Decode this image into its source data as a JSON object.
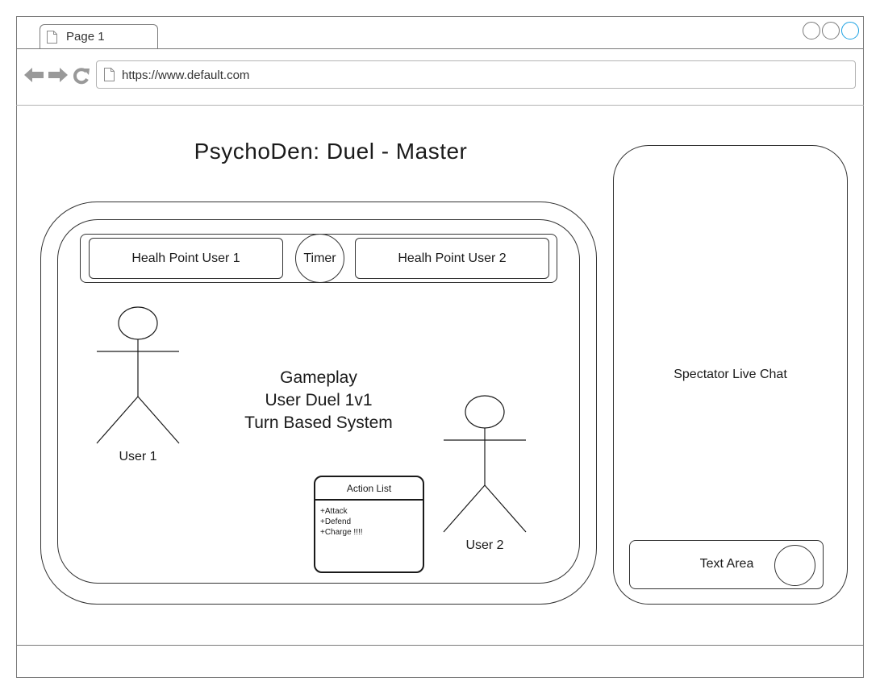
{
  "browser": {
    "tab": {
      "label": "Page 1",
      "icon": "page-icon"
    },
    "window_controls": [
      "circle-button",
      "circle-button",
      "circle-button"
    ],
    "nav": {
      "back_icon": "back-arrow-icon",
      "forward_icon": "forward-arrow-icon",
      "reload_icon": "reload-icon"
    },
    "address_bar": {
      "url": "https://www.default.com",
      "icon": "page-icon"
    },
    "colors": {
      "frame": "#7a7a7a",
      "active_control": "#1ba1e2",
      "nav_icons": "#999999"
    }
  },
  "page": {
    "title": "PsychoDen: Duel - Master"
  },
  "arena": {
    "hud": {
      "hp_user_1": "Healh Point User 1",
      "timer": "Timer",
      "hp_user_2": "Healh Point User 2"
    },
    "gameplay": {
      "line_1": "Gameplay",
      "line_2": "User Duel 1v1",
      "line_3": "Turn Based System"
    },
    "players": {
      "user_1": "User 1",
      "user_2": "User 2"
    },
    "action_list": {
      "title": "Action List",
      "items": [
        "+Attack",
        "+Defend",
        "+Charge !!!!"
      ]
    }
  },
  "chat": {
    "label": "Spectator Live Chat",
    "text_area": "Text Area"
  }
}
